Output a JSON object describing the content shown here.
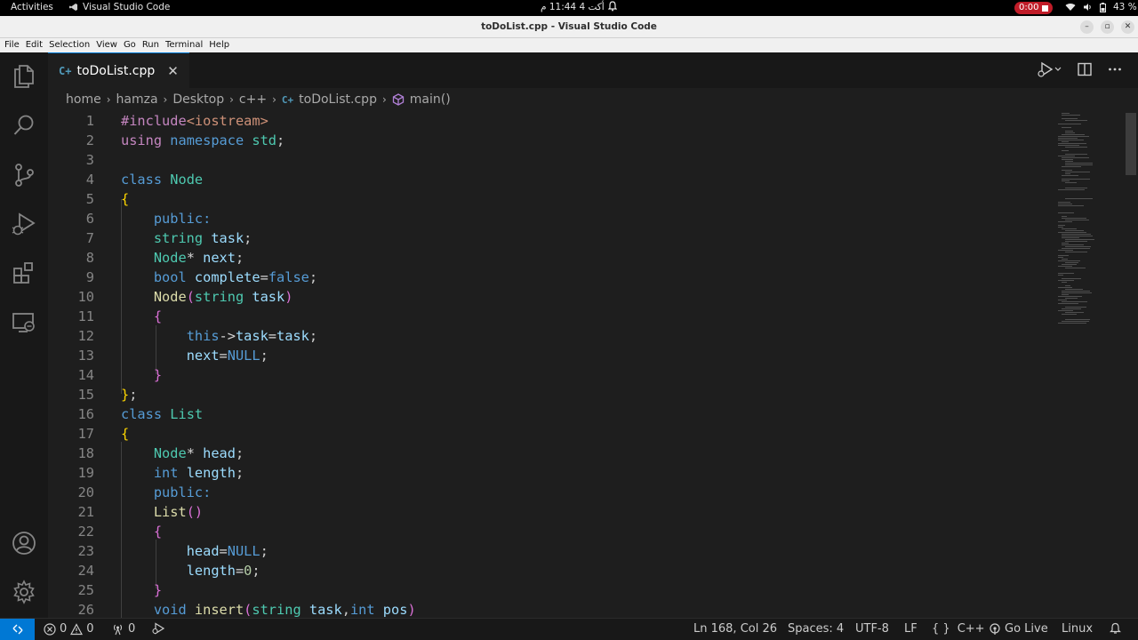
{
  "topbar": {
    "activities": "Activities",
    "app": "Visual Studio Code",
    "clock": "أكت 4  11:44 م",
    "record_time": "0:00",
    "battery": "43 %"
  },
  "window": {
    "title": "toDoList.cpp - Visual Studio Code"
  },
  "menu": [
    "File",
    "Edit",
    "Selection",
    "View",
    "Go",
    "Run",
    "Terminal",
    "Help"
  ],
  "tab": {
    "lang": "C+",
    "name": "toDoList.cpp"
  },
  "breadcrumb": {
    "items": [
      "home",
      "hamza",
      "Desktop",
      "c++"
    ],
    "lang": "C+",
    "file": "toDoList.cpp",
    "symbol": "main()"
  },
  "editor": {
    "line_numbers": [
      "1",
      "2",
      "3",
      "4",
      "5",
      "6",
      "7",
      "8",
      "9",
      "10",
      "11",
      "12",
      "13",
      "14",
      "15",
      "16",
      "17",
      "18",
      "19",
      "20",
      "21",
      "22",
      "23",
      "24",
      "25",
      "26"
    ]
  },
  "status": {
    "errors": "0",
    "warnings": "0",
    "ports": "0",
    "position": "Ln 168, Col 26",
    "spaces": "Spaces: 4",
    "encoding": "UTF-8",
    "eol": "LF",
    "braces": "{ }",
    "language": "C++",
    "golive": "Go Live",
    "os": "Linux"
  },
  "colors": {
    "accent": "#0078d4",
    "record": "#c01c28"
  }
}
